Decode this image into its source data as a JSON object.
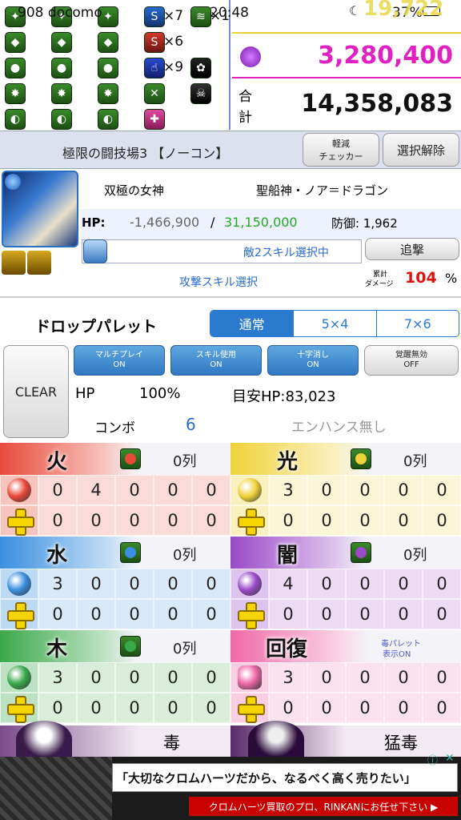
{
  "status": {
    "carrier": "908 docomo",
    "time": "20:48",
    "battery": "37%",
    "overlay_number": "19,722"
  },
  "awakenings": {
    "counts": [
      "×7",
      "×1",
      "×6",
      "×9"
    ]
  },
  "stats": {
    "magenta_value": "3,280,400",
    "total_label_top": "合",
    "total_label_bottom": "計",
    "total_value": "14,358,083"
  },
  "stage": {
    "title": "極限の闘技場3 【ノーコン】",
    "checker_line1": "軽減",
    "checker_line2": "チェッカー",
    "deselect": "選択解除"
  },
  "enemy": {
    "name1": "双極の女神",
    "name2": "聖船神・ノア＝ドラゴン",
    "hp_label": "HP:",
    "hp_damage": "-1,466,900",
    "hp_sep": "/",
    "hp_max": "31,150,000",
    "defense": "防御: 1,962",
    "skill_status": "敵2スキル選択中",
    "attack_skill": "攻撃スキル選択",
    "pursuit": "追撃",
    "cum_label1": "累計",
    "cum_label2": "ダメージ",
    "cum_value": "104",
    "cum_unit": "%"
  },
  "palette": {
    "title": "ドロップパレット",
    "tabs": [
      "通常",
      "5×4",
      "7×6"
    ],
    "clear": "CLEAR",
    "toggles": [
      {
        "l1": "マルチプレイ",
        "l2": "ON"
      },
      {
        "l1": "スキル使用",
        "l2": "ON"
      },
      {
        "l1": "十字消し",
        "l2": "ON"
      },
      {
        "l1": "覚醒無効",
        "l2": "OFF"
      }
    ],
    "hp_label": "HP",
    "hp_value": "100%",
    "est_hp": "目安HP:83,023",
    "combo_label": "コンボ",
    "combo_value": "6",
    "enhance": "エンハンス無し"
  },
  "sections": [
    {
      "label": "火",
      "lines": "0列",
      "row1": [
        "0",
        "4",
        "0",
        "0",
        "0"
      ],
      "row2": [
        "0",
        "0",
        "0",
        "0",
        "0"
      ]
    },
    {
      "label": "光",
      "lines": "0列",
      "row1": [
        "3",
        "0",
        "0",
        "0",
        "0"
      ],
      "row2": [
        "0",
        "0",
        "0",
        "0",
        "0"
      ]
    },
    {
      "label": "水",
      "lines": "0列",
      "row1": [
        "3",
        "0",
        "0",
        "0",
        "0"
      ],
      "row2": [
        "0",
        "0",
        "0",
        "0",
        "0"
      ]
    },
    {
      "label": "闇",
      "lines": "0列",
      "row1": [
        "4",
        "0",
        "0",
        "0",
        "0"
      ],
      "row2": [
        "0",
        "0",
        "0",
        "0",
        "0"
      ]
    },
    {
      "label": "木",
      "lines": "0列",
      "row1": [
        "3",
        "0",
        "0",
        "0",
        "0"
      ],
      "row2": [
        "0",
        "0",
        "0",
        "0",
        "0"
      ]
    },
    {
      "label": "回復",
      "lines": "",
      "row1": [
        "3",
        "0",
        "0",
        "0",
        "0"
      ],
      "row2": [
        "0",
        "0",
        "0",
        "0",
        "0"
      ]
    }
  ],
  "poison_note": {
    "l1": "毒パレット",
    "l2": "表示ON"
  },
  "poison": {
    "left": "毒",
    "right": "猛毒"
  },
  "ad": {
    "text1": "「大切なクロムハーツだから、なるべく高く売りたい」",
    "text2": "クロムハーツ買取のプロ、RINKANにお任せ下さい ▶"
  },
  "colors": {
    "fire": "#e84a3a",
    "water": "#3a8fe0",
    "wood": "#3aa84a",
    "light": "#f0d23a",
    "dark": "#9a4ac8",
    "heal": "#f06aa8",
    "green_hp": "#22aa22",
    "magenta": "#e020c0",
    "red": "#e01010"
  }
}
